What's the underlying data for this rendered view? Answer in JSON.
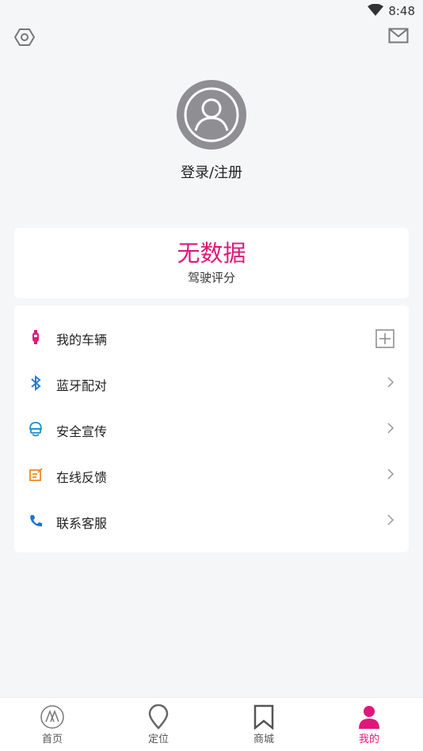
{
  "status_bar": {
    "time": "8:48"
  },
  "profile": {
    "login_text": "登录/注册"
  },
  "score": {
    "value": "无数据",
    "label": "驾驶评分"
  },
  "menu": [
    {
      "label": "我的车辆",
      "icon": "scooter-icon",
      "right": "add-icon"
    },
    {
      "label": "蓝牙配对",
      "icon": "bluetooth-icon",
      "right": "chevron-right-icon"
    },
    {
      "label": "安全宣传",
      "icon": "helmet-icon",
      "right": "chevron-right-icon"
    },
    {
      "label": "在线反馈",
      "icon": "edit-icon",
      "right": "chevron-right-icon"
    },
    {
      "label": "联系客服",
      "icon": "phone-icon",
      "right": "chevron-right-icon"
    }
  ],
  "tabs": [
    {
      "label": "首页",
      "icon": "home-logo-icon"
    },
    {
      "label": "定位",
      "icon": "location-pin-icon"
    },
    {
      "label": "商城",
      "icon": "bookmark-icon"
    },
    {
      "label": "我的",
      "icon": "person-icon",
      "active": true
    }
  ],
  "colors": {
    "accent": "#e0177a",
    "bluetooth": "#2a7bd6",
    "helmet": "#1a8fc9",
    "edit": "#f08a24",
    "phone": "#1e6fd9"
  }
}
